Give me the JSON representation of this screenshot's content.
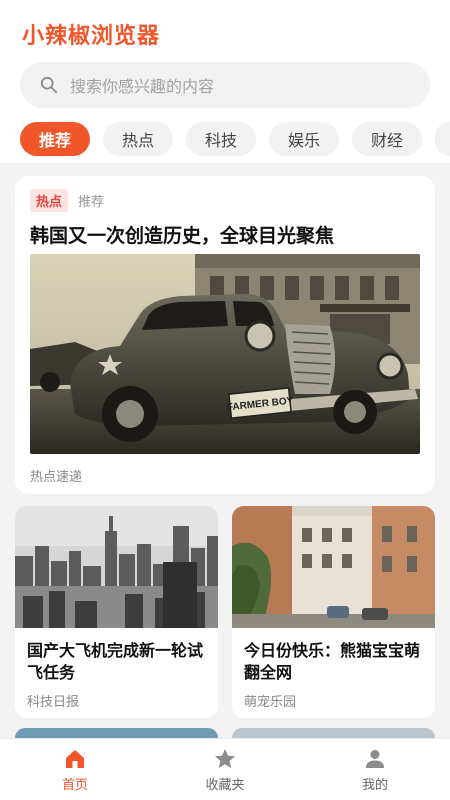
{
  "app": {
    "title": "小辣椒浏览器"
  },
  "search": {
    "placeholder": "搜索你感兴趣的内容"
  },
  "tabs": [
    {
      "label": "推荐",
      "active": true
    },
    {
      "label": "热点",
      "active": false
    },
    {
      "label": "科技",
      "active": false
    },
    {
      "label": "娱乐",
      "active": false
    },
    {
      "label": "财经",
      "active": false
    }
  ],
  "feature": {
    "badge": "热点",
    "tag": "推荐",
    "title": "韩国又一次创造历史，全球目光聚焦",
    "plate_text": "FARMER BOY",
    "source": "热点速递"
  },
  "cards": [
    {
      "title": "国产大飞机完成新一轮试飞任务",
      "source": "科技日报"
    },
    {
      "title": "今日份快乐：熊猫宝宝萌翻全网",
      "source": "萌宠乐园"
    }
  ],
  "nav": [
    {
      "label": "首页",
      "icon": "home-icon",
      "active": true
    },
    {
      "label": "收藏夹",
      "icon": "star-icon",
      "active": false
    },
    {
      "label": "我的",
      "icon": "profile-icon",
      "active": false
    }
  ],
  "colors": {
    "accent": "#f0562a",
    "hot_badge_bg": "#fde4e2",
    "hot_badge_text": "#e7473c"
  }
}
